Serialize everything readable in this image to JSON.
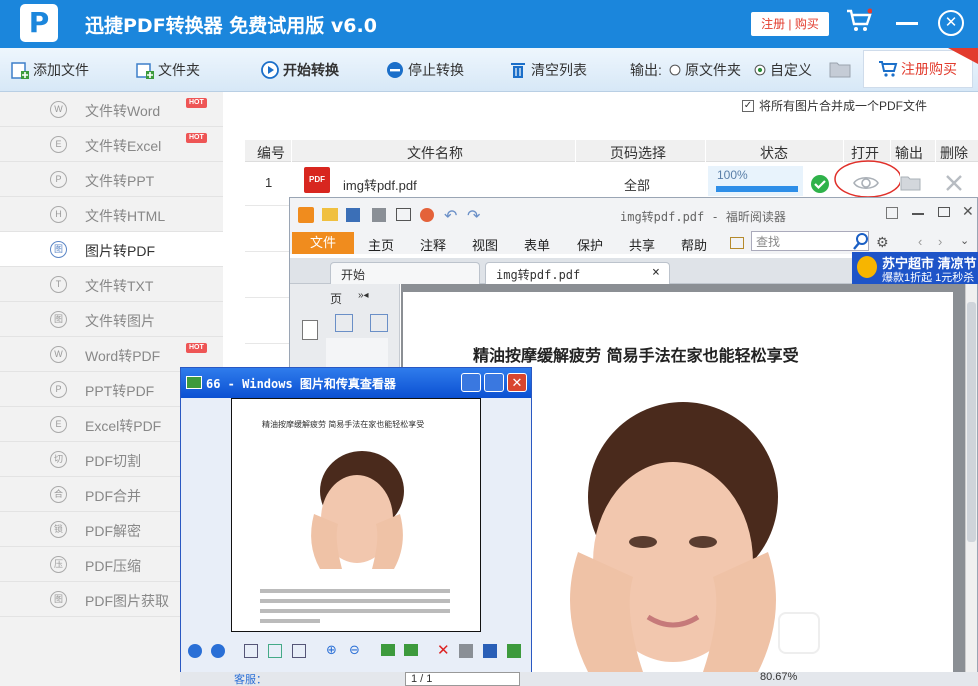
{
  "app": {
    "logo_glyph": "P",
    "title": "迅捷PDF转换器 免费试用版 v6.0",
    "register_buy": "注册 | 购买",
    "close_glyph": "✕"
  },
  "toolbar": {
    "add_file": "添加文件",
    "add_folder": "文件夹",
    "start": "开始转换",
    "stop": "停止转换",
    "clear": "清空列表",
    "output_label": "输出:",
    "output_original": "原文件夹",
    "output_custom": "自定义",
    "register_buy": "注册购买"
  },
  "sidebar": {
    "items": [
      {
        "label": "文件转Word",
        "glyph": "W",
        "hot": "HOT"
      },
      {
        "label": "文件转Excel",
        "glyph": "E",
        "hot": "HOT"
      },
      {
        "label": "文件转PPT",
        "glyph": "P",
        "hot": ""
      },
      {
        "label": "文件转HTML",
        "glyph": "H",
        "hot": ""
      },
      {
        "label": "图片转PDF",
        "glyph": "图",
        "hot": ""
      },
      {
        "label": "文件转TXT",
        "glyph": "T",
        "hot": ""
      },
      {
        "label": "文件转图片",
        "glyph": "图",
        "hot": ""
      },
      {
        "label": "Word转PDF",
        "glyph": "W",
        "hot": "HOT"
      },
      {
        "label": "PPT转PDF",
        "glyph": "P",
        "hot": ""
      },
      {
        "label": "Excel转PDF",
        "glyph": "E",
        "hot": ""
      },
      {
        "label": "PDF切割",
        "glyph": "切",
        "hot": ""
      },
      {
        "label": "PDF合并",
        "glyph": "合",
        "hot": ""
      },
      {
        "label": "PDF解密",
        "glyph": "锁",
        "hot": ""
      },
      {
        "label": "PDF压缩",
        "glyph": "压",
        "hot": ""
      },
      {
        "label": "PDF图片获取",
        "glyph": "图",
        "hot": ""
      }
    ],
    "active": "图片转PDF"
  },
  "merge_option": {
    "label": "将所有图片合并成一个PDF文件",
    "checked": true
  },
  "table": {
    "headers": [
      "编号",
      "文件名称",
      "页码选择",
      "状态",
      "打开",
      "输出",
      "删除"
    ],
    "rows": [
      {
        "index": "1",
        "icon_text": "PDF",
        "filename": "img转pdf.pdf",
        "pages": "全部",
        "progress_text": "100%",
        "progress": 1.0
      }
    ]
  },
  "foxit": {
    "title": "img转pdf.pdf - 福昕阅读器",
    "menu": [
      "文件",
      "主页",
      "注释",
      "视图",
      "表单",
      "保护",
      "共享",
      "帮助"
    ],
    "search_placeholder": "查找",
    "tabs": [
      "开始",
      "img转pdf.pdf"
    ],
    "tab_close": "×",
    "left_panel_label": "页",
    "pdf_heading": "精油按摩缓解疲劳 简易手法在家也能轻松享受",
    "ad_line1": "苏宁超市 清凉节",
    "ad_line2": "爆款1折起 1元秒杀"
  },
  "viewer": {
    "title": "66 - Windows 图片和传真查看器",
    "page_heading": "精油按摩缓解疲劳 简易手法在家也能轻松享受"
  },
  "status": {
    "service": "客服：",
    "page": "1 / 1",
    "zoom": "80.67%"
  },
  "colors": {
    "brand_blue": "#1b86dc",
    "accent_red": "#e23c2e",
    "foxit_orange": "#f08c1e",
    "progress_blue": "#2d8ee8",
    "success_green": "#2fb24a"
  }
}
